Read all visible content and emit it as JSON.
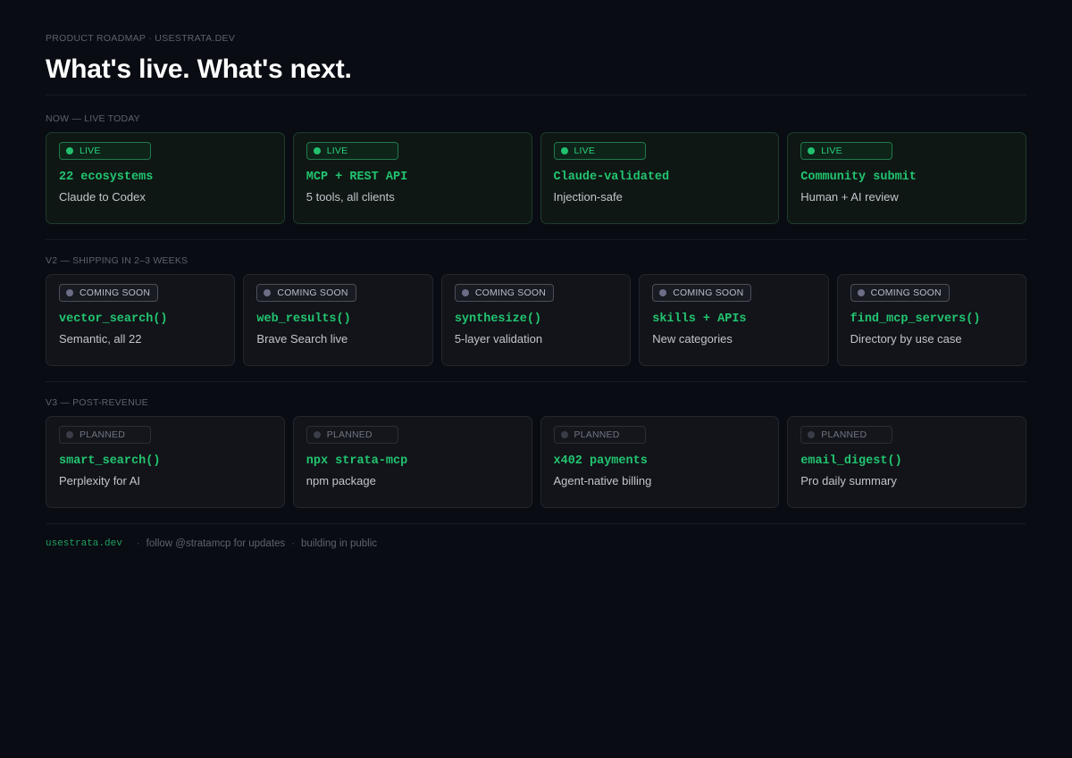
{
  "header": {
    "eyebrow": "PRODUCT ROADMAP · USESTRATA.DEV",
    "title": "What's live. What's next."
  },
  "sections": {
    "now": {
      "label": "NOW — LIVE TODAY",
      "items": [
        {
          "status": "LIVE",
          "title": "22 ecosystems",
          "subtitle": "Claude to Codex"
        },
        {
          "status": "LIVE",
          "title": "MCP + REST API",
          "subtitle": "5 tools, all clients"
        },
        {
          "status": "LIVE",
          "title": "Claude-validated",
          "subtitle": "Injection-safe"
        },
        {
          "status": "LIVE",
          "title": "Community submit",
          "subtitle": "Human + AI review"
        }
      ]
    },
    "v2": {
      "label": "V2 — SHIPPING IN 2–3 WEEKS",
      "items": [
        {
          "status": "COMING SOON",
          "title": "vector_search()",
          "subtitle": "Semantic, all 22"
        },
        {
          "status": "COMING SOON",
          "title": "web_results()",
          "subtitle": "Brave Search live"
        },
        {
          "status": "COMING SOON",
          "title": "synthesize()",
          "subtitle": "5-layer validation"
        },
        {
          "status": "COMING SOON",
          "title": "skills + APIs",
          "subtitle": "New categories"
        },
        {
          "status": "COMING SOON",
          "title": "find_mcp_servers()",
          "subtitle": "Directory by use case"
        }
      ]
    },
    "v3": {
      "label": "V3 — POST-REVENUE",
      "items": [
        {
          "status": "PLANNED",
          "title": "smart_search()",
          "subtitle": "Perplexity for AI"
        },
        {
          "status": "PLANNED",
          "title": "npx strata-mcp",
          "subtitle": "npm package"
        },
        {
          "status": "PLANNED",
          "title": "x402 payments",
          "subtitle": "Agent-native billing"
        },
        {
          "status": "PLANNED",
          "title": "email_digest()",
          "subtitle": "Pro daily summary"
        }
      ]
    }
  },
  "footer": {
    "site": "usestrata.dev",
    "separator": "·",
    "follow": "follow @stratamcp for updates",
    "note": "building in public"
  },
  "colors": {
    "background": "#090c12",
    "accent_green": "#22c570",
    "live_border": "#1f7a4c",
    "soon_border": "#4c4f5c",
    "planned_border": "#2b2e37"
  },
  "icons": {
    "live": "status-dot-icon",
    "coming_soon": "status-dot-icon",
    "planned": "status-dot-icon"
  }
}
